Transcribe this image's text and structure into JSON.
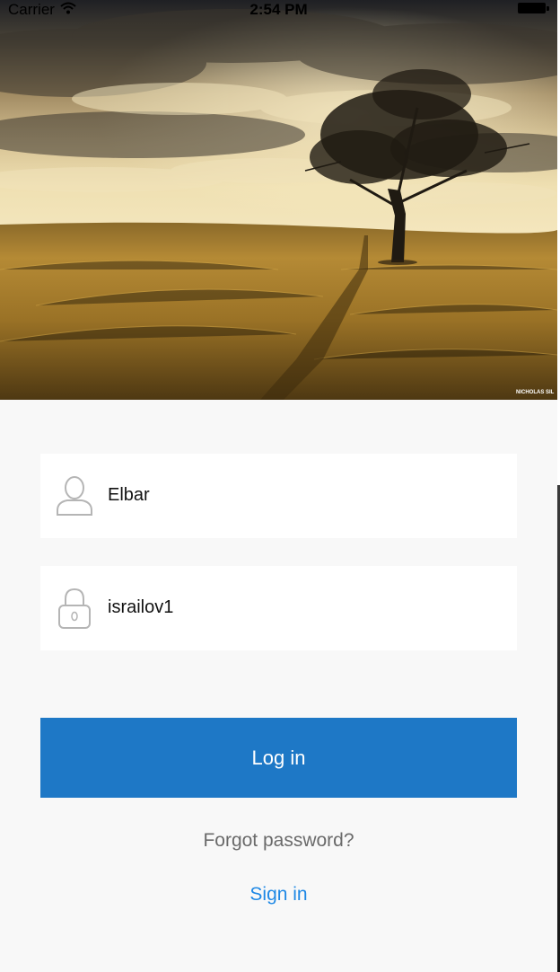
{
  "status_bar": {
    "carrier": "Carrier",
    "time": "2:54 PM"
  },
  "hero": {
    "watermark": "NICHOLAS SIL"
  },
  "login_form": {
    "username_value": "Elbar",
    "password_value": "israilov1",
    "login_label": "Log in",
    "forgot_label": "Forgot password?",
    "signin_label": "Sign in"
  },
  "colors": {
    "primary_button": "#1e78c6",
    "link": "#1e88e5",
    "secondary_text": "#6a6a6a",
    "background": "#f8f8f8"
  },
  "icons": {
    "status_bar": [
      "wifi-icon",
      "battery-icon"
    ],
    "username_field": "user-icon",
    "password_field": "lock-icon"
  }
}
